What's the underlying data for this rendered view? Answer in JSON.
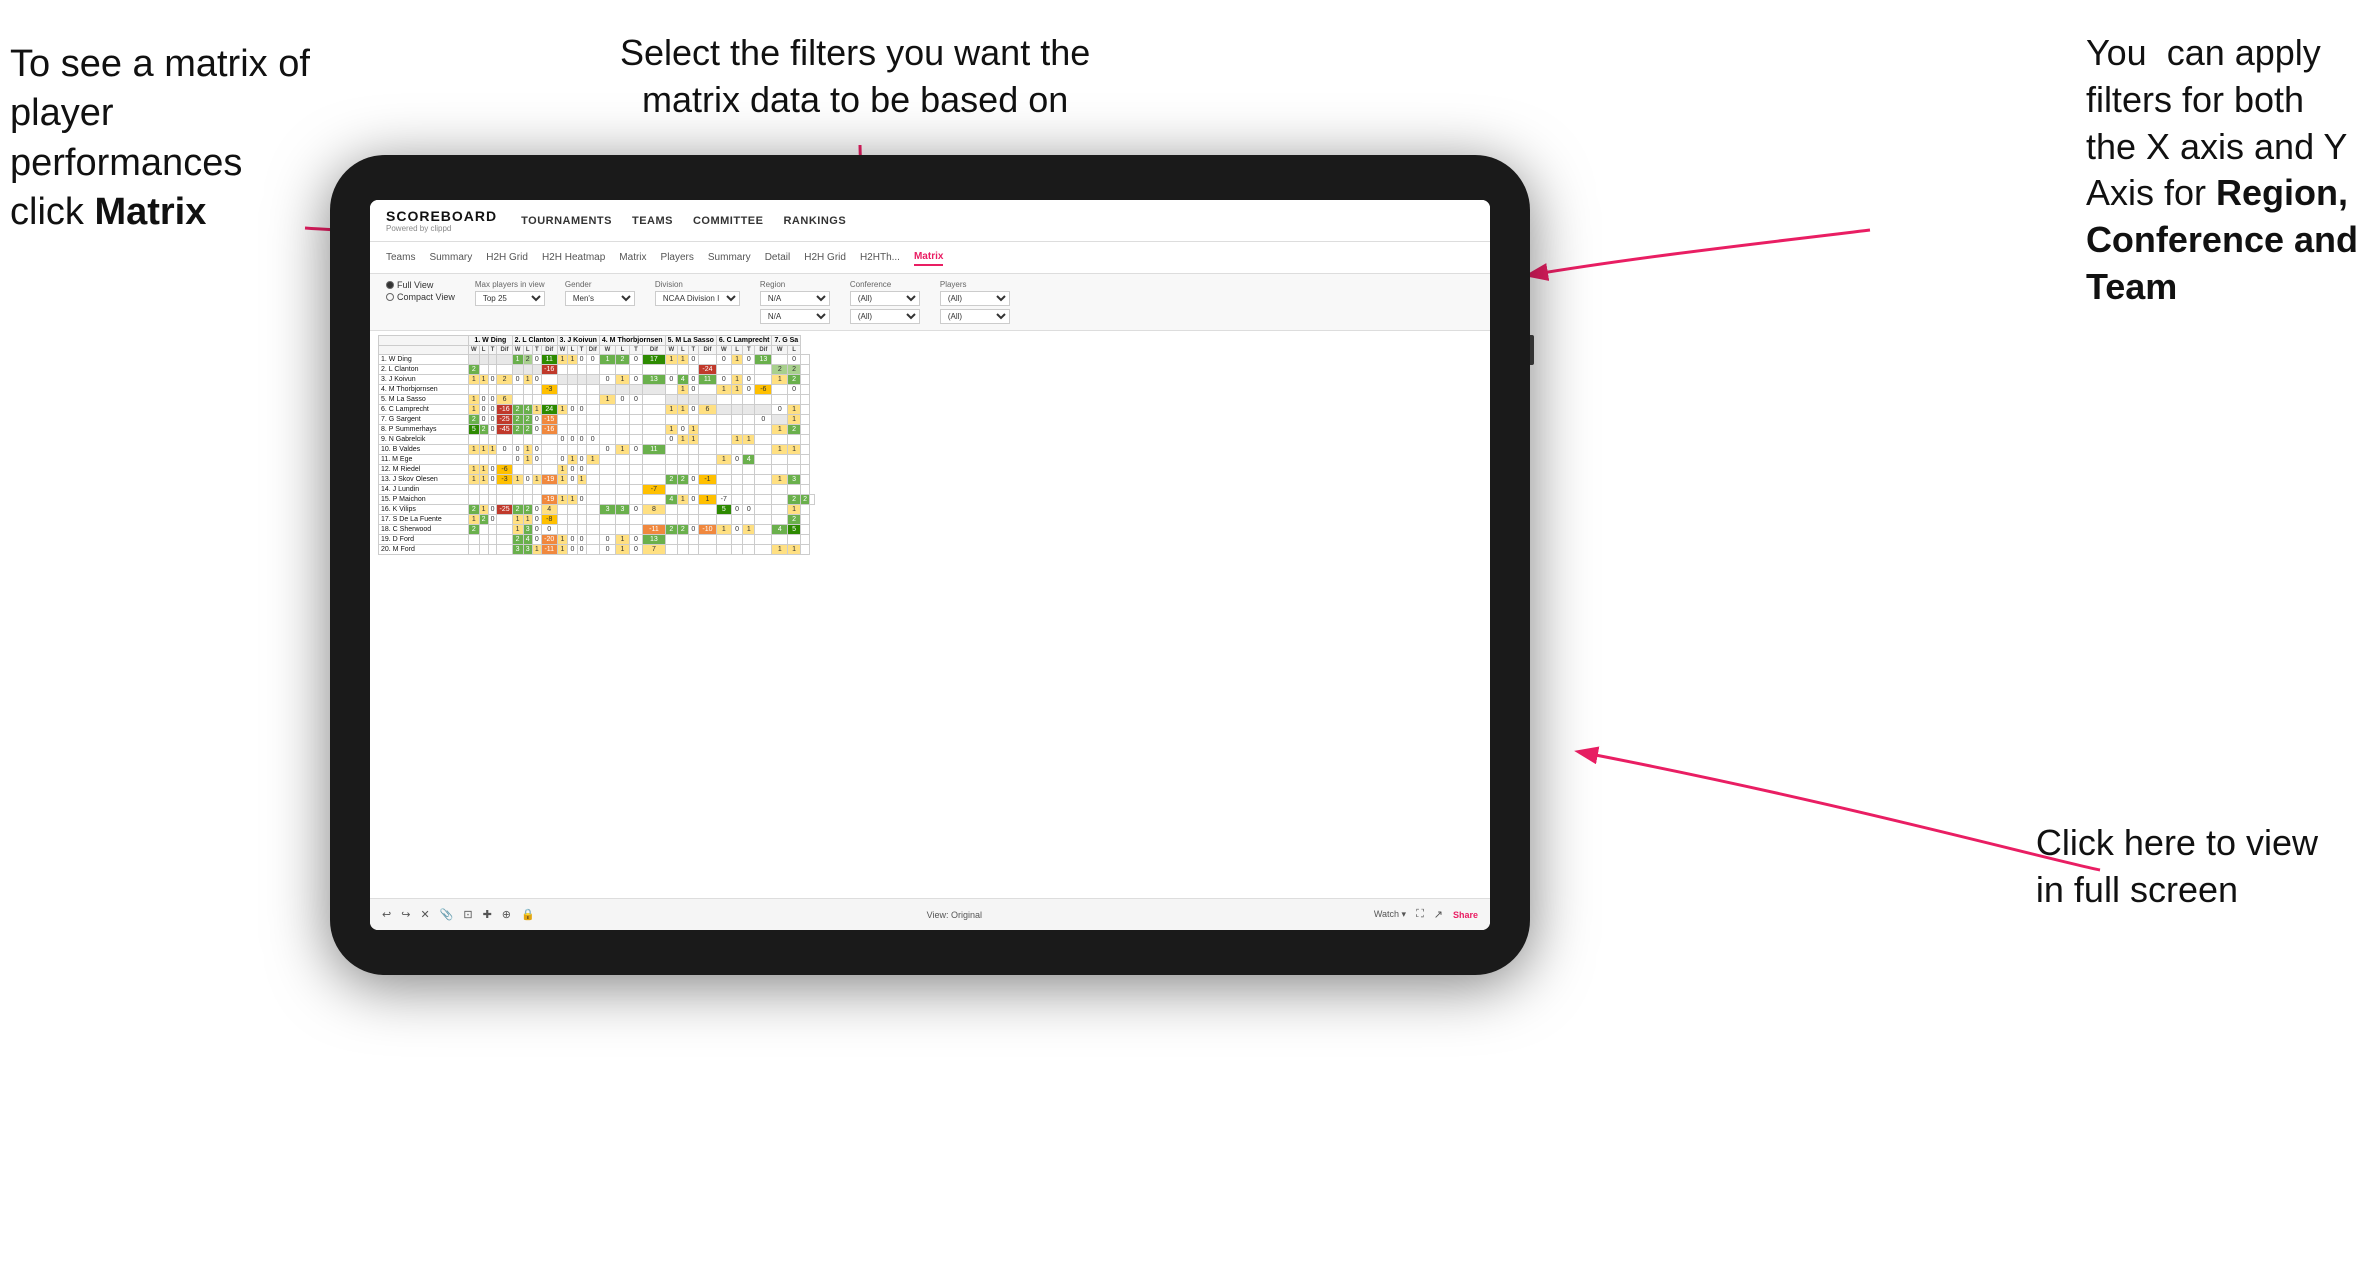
{
  "annotations": {
    "top_left": {
      "line1": "To see a matrix of",
      "line2": "player performances",
      "line3": "click ",
      "bold": "Matrix"
    },
    "top_center": {
      "text": "Select the filters you want the\nmatrix data to be based on"
    },
    "top_right": {
      "line1": "You  can apply",
      "line2": "filters for both",
      "line3": "the X axis and Y",
      "line4": "Axis for ",
      "bold1": "Region,",
      "line5": "",
      "bold2": "Conference and",
      "bold3": "Team"
    },
    "bottom_right": {
      "line1": "Click here to view",
      "line2": "in full screen"
    }
  },
  "nav": {
    "logo": "SCOREBOARD",
    "logo_sub": "Powered by clippd",
    "items": [
      "TOURNAMENTS",
      "TEAMS",
      "COMMITTEE",
      "RANKINGS"
    ]
  },
  "sub_nav": {
    "items": [
      "Teams",
      "Summary",
      "H2H Grid",
      "H2H Heatmap",
      "Matrix",
      "Players",
      "Summary",
      "Detail",
      "H2H Grid",
      "H2HTh...",
      "Matrix"
    ],
    "active": "Matrix"
  },
  "filters": {
    "view_options": [
      "Full View",
      "Compact View"
    ],
    "max_players": "Top 25",
    "gender": "Men's",
    "division": "NCAA Division I",
    "region": "N/A",
    "conference": "(All)",
    "players": "(All)"
  },
  "matrix": {
    "col_headers": [
      "1. W Ding",
      "2. L Clanton",
      "3. J Koivun",
      "4. M Thorbjornsen",
      "5. M La Sasso",
      "6. C Lamprecht",
      "7. G Sa"
    ],
    "sub_cols": [
      "W",
      "L",
      "T",
      "Dif"
    ],
    "rows": [
      {
        "name": "1. W Ding",
        "cells": [
          [
            "",
            "",
            "",
            ""
          ],
          [
            "1",
            "2",
            "0",
            "11"
          ],
          [
            "1",
            "1",
            "0",
            "0"
          ],
          [
            "1",
            "2",
            "0",
            "17"
          ],
          [
            "1",
            "1",
            "0",
            ""
          ],
          [
            "0",
            "1",
            "0",
            "13"
          ],
          [
            "",
            "0",
            ""
          ]
        ]
      },
      {
        "name": "2. L Clanton",
        "cells": [
          [
            "2",
            "",
            "",
            ""
          ],
          [
            "",
            "",
            "",
            "-16"
          ],
          [
            "",
            "",
            "",
            ""
          ],
          [
            "",
            "",
            "",
            ""
          ],
          [
            "",
            "",
            "",
            "-24"
          ],
          [
            "",
            "",
            "",
            ""
          ],
          [
            "2",
            "2",
            ""
          ]
        ]
      },
      {
        "name": "3. J Koivun",
        "cells": [
          [
            "1",
            "1",
            "0",
            "2"
          ],
          [
            "0",
            "1",
            "0",
            ""
          ],
          [
            "",
            "",
            "",
            ""
          ],
          [
            "0",
            "1",
            "0",
            "13"
          ],
          [
            "0",
            "4",
            "0",
            "11"
          ],
          [
            "0",
            "1",
            "0",
            ""
          ],
          [
            "1",
            "2",
            ""
          ]
        ]
      },
      {
        "name": "4. M Thorbjornsen",
        "cells": [
          [
            "",
            "",
            "",
            ""
          ],
          [
            "",
            "",
            "",
            "-3"
          ],
          [
            "",
            "",
            "",
            ""
          ],
          [
            "",
            "",
            "",
            ""
          ],
          [
            "",
            "1",
            "0",
            ""
          ],
          [
            "1",
            "1",
            "0",
            "-6"
          ],
          [
            "",
            "0",
            ""
          ]
        ]
      },
      {
        "name": "5. M La Sasso",
        "cells": [
          [
            "1",
            "0",
            "0",
            "6"
          ],
          [
            "",
            "",
            "",
            ""
          ],
          [
            "",
            "",
            "",
            ""
          ],
          [
            "1",
            "0",
            "0",
            ""
          ],
          [
            "",
            "",
            "",
            ""
          ],
          [
            "",
            "",
            "",
            ""
          ],
          [
            "",
            "",
            ""
          ]
        ]
      },
      {
        "name": "6. C Lamprecht",
        "cells": [
          [
            "1",
            "0",
            "0",
            "-16"
          ],
          [
            "2",
            "4",
            "1",
            "24"
          ],
          [
            "1",
            "0",
            "0",
            ""
          ],
          [
            "",
            "",
            "",
            ""
          ],
          [
            "1",
            "1",
            "0",
            "6"
          ],
          [
            "",
            "",
            "",
            ""
          ],
          [
            "0",
            "1",
            ""
          ]
        ]
      },
      {
        "name": "7. G Sargent",
        "cells": [
          [
            "2",
            "0",
            "0",
            "-25"
          ],
          [
            "2",
            "2",
            "0",
            "-15"
          ],
          [
            "",
            "",
            "",
            ""
          ],
          [
            "",
            "",
            "",
            ""
          ],
          [
            "",
            "",
            "",
            ""
          ],
          [
            "",
            "",
            "",
            "0"
          ],
          [
            "",
            "1",
            ""
          ]
        ]
      },
      {
        "name": "8. P Summerhays",
        "cells": [
          [
            "5",
            "2",
            "0",
            "-45"
          ],
          [
            "2",
            "2",
            "0",
            "-16"
          ],
          [
            "",
            "",
            "",
            ""
          ],
          [
            "",
            "",
            "",
            ""
          ],
          [
            "1",
            "0",
            "1",
            ""
          ],
          [
            "",
            "",
            "",
            ""
          ],
          [
            "1",
            "2",
            ""
          ]
        ]
      },
      {
        "name": "9. N Gabrelcik",
        "cells": [
          [
            "",
            "",
            "",
            ""
          ],
          [
            "",
            "",
            "",
            ""
          ],
          [
            "0",
            "0",
            "0",
            "0"
          ],
          [
            "",
            "",
            "",
            ""
          ],
          [
            "0",
            "1",
            "1",
            ""
          ],
          [
            "",
            "1",
            "1",
            ""
          ],
          [
            "",
            "",
            ""
          ]
        ]
      },
      {
        "name": "10. B Valdes",
        "cells": [
          [
            "1",
            "1",
            "1",
            "0"
          ],
          [
            "0",
            "1",
            "0",
            ""
          ],
          [
            "",
            "",
            "",
            ""
          ],
          [
            "0",
            "1",
            "0",
            "11"
          ],
          [
            "",
            "",
            "",
            ""
          ],
          [
            "",
            "",
            "",
            ""
          ],
          [
            "1",
            "1",
            ""
          ]
        ]
      },
      {
        "name": "11. M Ege",
        "cells": [
          [
            "",
            "",
            "",
            ""
          ],
          [
            "0",
            "1",
            "0",
            ""
          ],
          [
            "0",
            "1",
            "0",
            "1"
          ],
          [
            "",
            "",
            "",
            ""
          ],
          [
            "",
            "",
            "",
            ""
          ],
          [
            "1",
            "0",
            "4",
            ""
          ],
          [
            "",
            "",
            ""
          ]
        ]
      },
      {
        "name": "12. M Riedel",
        "cells": [
          [
            "1",
            "1",
            "0",
            "-6"
          ],
          [
            "",
            "",
            "",
            ""
          ],
          [
            "1",
            "0",
            "0",
            ""
          ],
          [
            "",
            "",
            "",
            ""
          ],
          [
            "",
            "",
            "",
            ""
          ],
          [
            "",
            "",
            "",
            ""
          ],
          [
            "",
            "",
            ""
          ]
        ]
      },
      {
        "name": "13. J Skov Olesen",
        "cells": [
          [
            "1",
            "1",
            "0",
            "-3"
          ],
          [
            "1",
            "0",
            "1",
            "-19"
          ],
          [
            "1",
            "0",
            "1",
            ""
          ],
          [
            "",
            "",
            "",
            ""
          ],
          [
            "2",
            "2",
            "0",
            "-1"
          ],
          [
            "",
            "",
            "",
            ""
          ],
          [
            "1",
            "3",
            ""
          ]
        ]
      },
      {
        "name": "14. J Lundin",
        "cells": [
          [
            "",
            "",
            "",
            ""
          ],
          [
            "",
            "",
            "",
            ""
          ],
          [
            "",
            "",
            "",
            ""
          ],
          [
            "",
            "",
            "",
            "-7"
          ],
          [
            "",
            "",
            "",
            ""
          ],
          [
            "",
            "",
            "",
            ""
          ],
          [
            "",
            "",
            ""
          ]
        ]
      },
      {
        "name": "15. P Maichon",
        "cells": [
          [
            "",
            "",
            "",
            ""
          ],
          [
            "",
            "",
            "",
            "-19"
          ],
          [
            "1",
            "1",
            "0",
            ""
          ],
          [
            "",
            "",
            "",
            ""
          ],
          [
            "4",
            "1",
            "0",
            "1",
            "-7"
          ],
          [
            "",
            "",
            "",
            ""
          ],
          [
            "2",
            "2",
            ""
          ]
        ]
      },
      {
        "name": "16. K Vilips",
        "cells": [
          [
            "2",
            "1",
            "0",
            "-25"
          ],
          [
            "2",
            "2",
            "0",
            "4"
          ],
          [
            "",
            "",
            "",
            ""
          ],
          [
            "3",
            "3",
            "0",
            "8"
          ],
          [
            "",
            "",
            "",
            ""
          ],
          [
            "5",
            "0",
            "0",
            ""
          ],
          [
            "",
            "1",
            ""
          ]
        ]
      },
      {
        "name": "17. S De La Fuente",
        "cells": [
          [
            "1",
            "2",
            "0",
            ""
          ],
          [
            "1",
            "1",
            "0",
            "-8"
          ],
          [
            "",
            "",
            "",
            ""
          ],
          [
            "",
            "",
            "",
            ""
          ],
          [
            "",
            "",
            "",
            ""
          ],
          [
            "",
            "",
            "",
            ""
          ],
          [
            "",
            "2",
            ""
          ]
        ]
      },
      {
        "name": "18. C Sherwood",
        "cells": [
          [
            "2",
            "",
            "",
            ""
          ],
          [
            "1",
            "3",
            "0",
            "0"
          ],
          [
            "",
            "",
            "",
            ""
          ],
          [
            "",
            "",
            "",
            "-11"
          ],
          [
            "2",
            "2",
            "0",
            "-10"
          ],
          [
            "1",
            "0",
            "1",
            ""
          ],
          [
            "4",
            "5",
            ""
          ]
        ]
      },
      {
        "name": "19. D Ford",
        "cells": [
          [
            "",
            "",
            "",
            ""
          ],
          [
            "2",
            "4",
            "0",
            "-20"
          ],
          [
            "1",
            "0",
            "0",
            ""
          ],
          [
            "0",
            "1",
            "0",
            "13"
          ],
          [
            "",
            "",
            "",
            ""
          ],
          [
            "",
            "",
            "",
            ""
          ],
          [
            "",
            "",
            ""
          ]
        ]
      },
      {
        "name": "20. M Ford",
        "cells": [
          [
            "",
            "",
            "",
            ""
          ],
          [
            "3",
            "3",
            "1",
            "-11"
          ],
          [
            "1",
            "0",
            "0",
            ""
          ],
          [
            "0",
            "1",
            "0",
            "7"
          ],
          [
            "",
            "",
            "",
            ""
          ],
          [
            "",
            "",
            "",
            ""
          ],
          [
            "1",
            "1",
            ""
          ]
        ]
      }
    ]
  },
  "bottom_bar": {
    "icons": [
      "↩",
      "↪",
      "✕",
      "📎",
      "⊡",
      "✚",
      "⊕",
      "🔒"
    ],
    "view_label": "View: Original",
    "watch_label": "Watch ▾",
    "share_label": "Share"
  },
  "cell_colors": {
    "description": "Color mapping based on win/loss differential"
  }
}
